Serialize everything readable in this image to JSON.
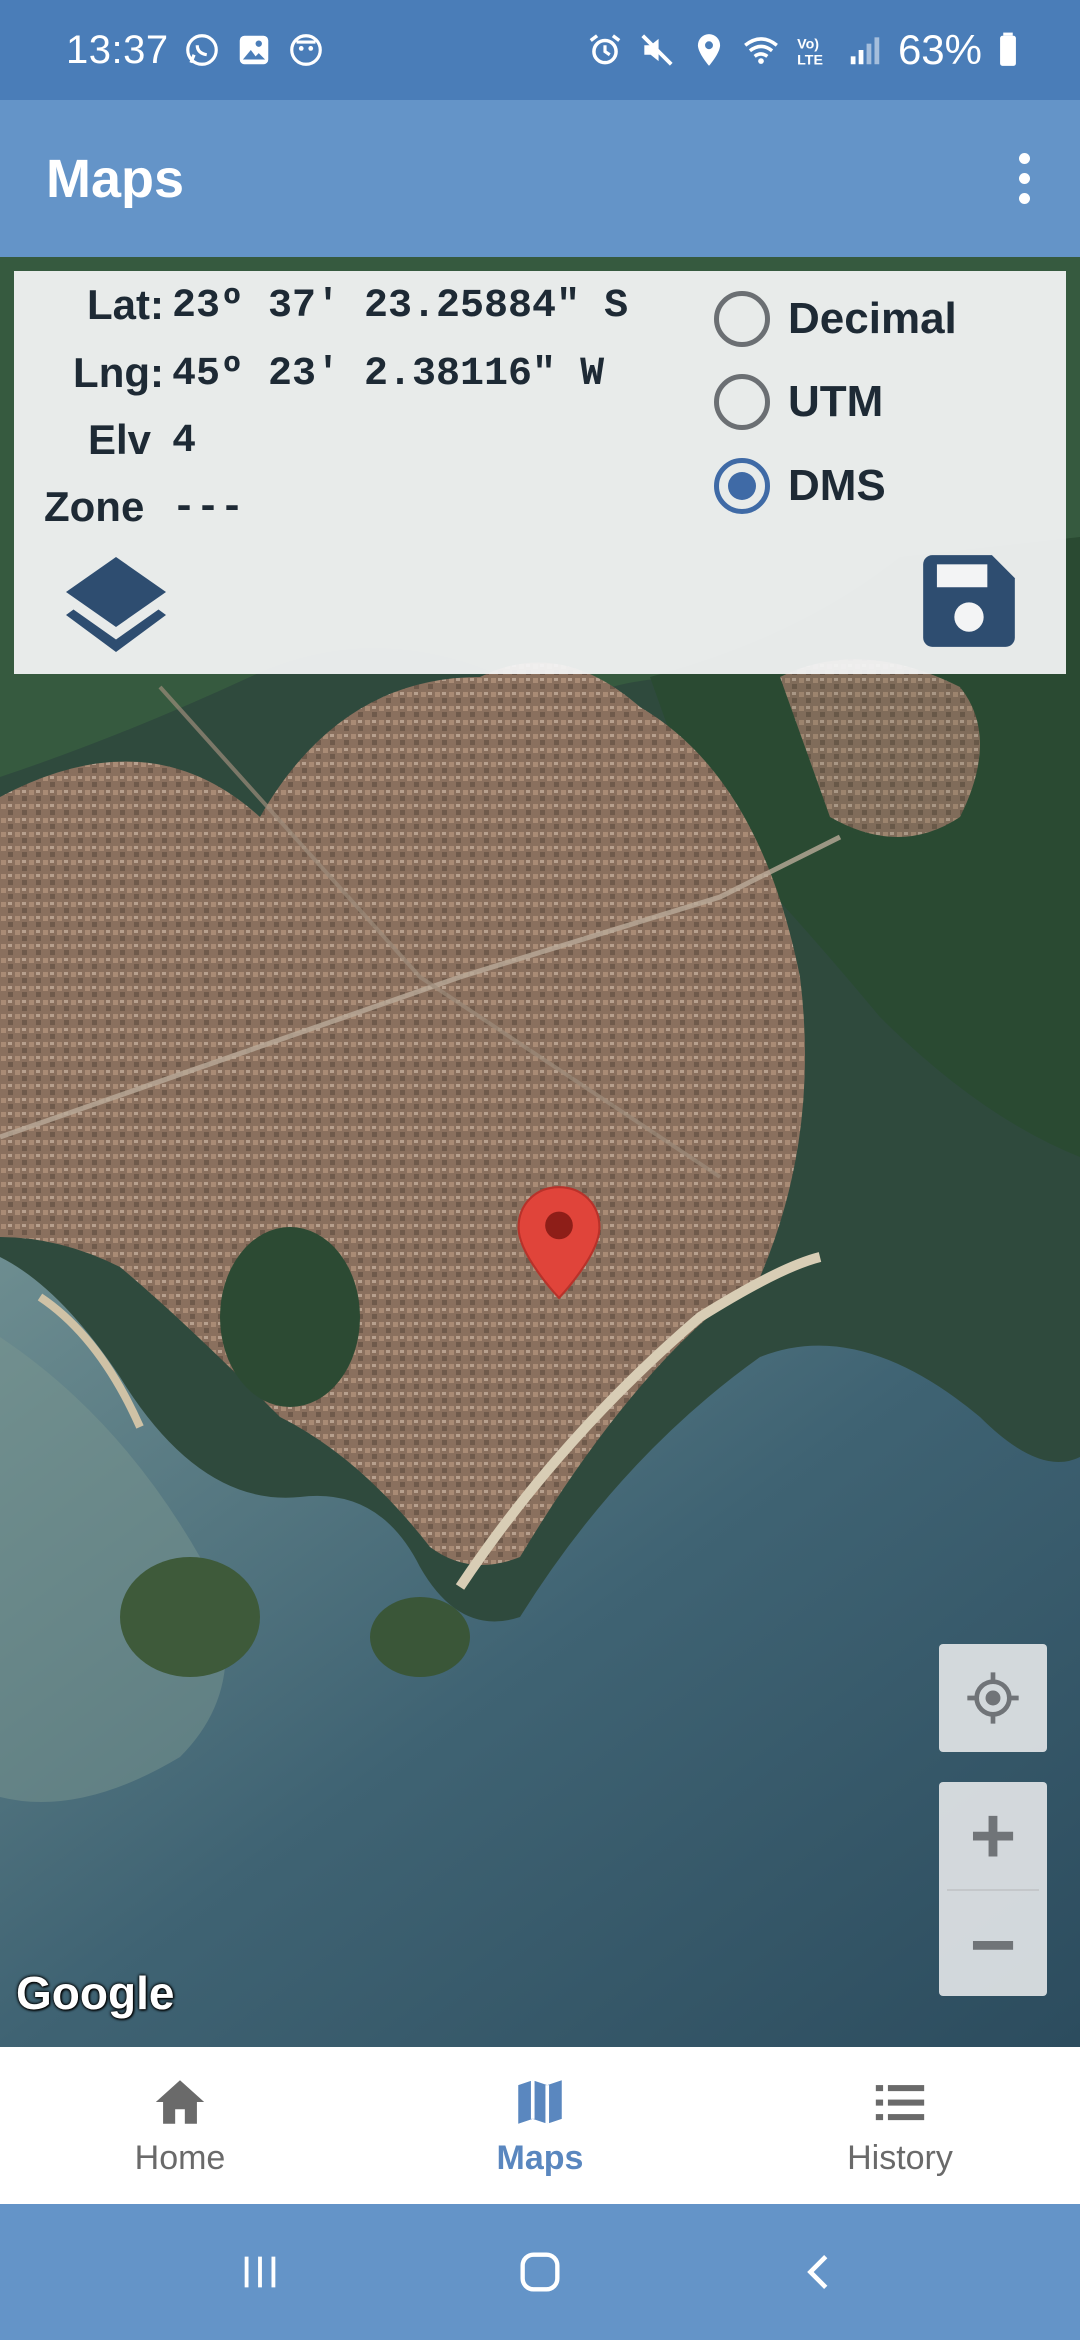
{
  "status_bar": {
    "time": "13:37",
    "battery": "63%",
    "left_icons": [
      "whatsapp-icon",
      "image-icon",
      "app-notification-icon"
    ],
    "right_icons": [
      "alarm-icon",
      "mute-icon",
      "location-icon",
      "wifi-icon",
      "volte-icon",
      "signal-icon",
      "battery-icon"
    ]
  },
  "app_bar": {
    "title": "Maps",
    "menu_icon": "more-vert-icon"
  },
  "coordinates": {
    "lat_label": "Lat:",
    "lat_value": "23º 37' 23.25884\" S",
    "lng_label": "Lng:",
    "lng_value": "45º 23' 2.38116\" W",
    "elv_label": "Elv",
    "elv_value": "4",
    "zone_label": "Zone",
    "zone_value": "---"
  },
  "format_options": {
    "options": [
      "Decimal",
      "UTM",
      "DMS"
    ],
    "selected": "DMS"
  },
  "map": {
    "attribution": "Google",
    "layers_icon": "layers-icon",
    "save_icon": "save-icon",
    "locate_icon": "my-location-icon",
    "zoom_in_label": "+",
    "zoom_out_label": "−",
    "marker_icon": "map-marker-icon",
    "marker_color": "#e0443a"
  },
  "bottom_nav": {
    "items": [
      {
        "label": "Home",
        "icon": "home-icon"
      },
      {
        "label": "Maps",
        "icon": "map-icon"
      },
      {
        "label": "History",
        "icon": "list-icon"
      }
    ],
    "active": "Maps"
  },
  "colors": {
    "status_bar": "#4a7db8",
    "app_bar": "#6494c8",
    "accent": "#3f6aa6",
    "active_nav": "#5a87bf"
  }
}
